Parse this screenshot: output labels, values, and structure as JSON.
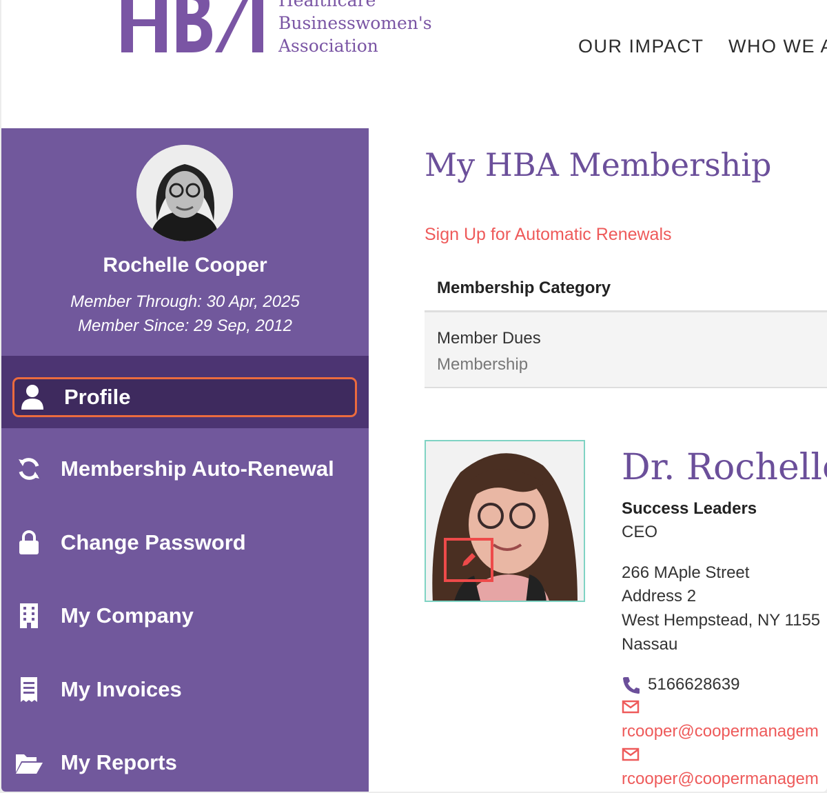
{
  "header": {
    "logo_lines": [
      "Healthcare",
      "Businesswomen's",
      "Association"
    ],
    "nav": [
      "OUR IMPACT",
      "WHO WE A"
    ]
  },
  "sidebar": {
    "member_name": "Rochelle Cooper",
    "member_through": "Member Through: 30 Apr, 2025",
    "member_since": "Member Since: 29 Sep, 2012",
    "items": [
      {
        "label": "Profile",
        "icon": "user-icon",
        "active": true
      },
      {
        "label": "Membership Auto-Renewal",
        "icon": "refresh-icon"
      },
      {
        "label": "Change Password",
        "icon": "lock-icon"
      },
      {
        "label": "My Company",
        "icon": "building-icon"
      },
      {
        "label": "My Invoices",
        "icon": "receipt-icon"
      },
      {
        "label": "My Reports",
        "icon": "folder-open-icon"
      }
    ]
  },
  "main": {
    "title": "My HBA Membership",
    "renew_link": "Sign Up for Automatic Renewals",
    "table": {
      "header": "Membership Category",
      "row_line1": "Member Dues",
      "row_line2": "Membership"
    },
    "card": {
      "name": "Dr. Rochelle",
      "company": "Success Leaders",
      "title": "CEO",
      "address1": "266 MAple Street",
      "address2": "Address 2",
      "city": "West Hempstead, NY 1155",
      "county": "Nassau",
      "phone": "5166628639",
      "email1": "rcooper@coopermanagem",
      "email2": "rcooper@coopermanagem"
    }
  },
  "colors": {
    "brand_purple": "#71589c",
    "active_purple": "#3e2a5e",
    "highlight_orange": "#ec6b3e",
    "link_red": "#ee5a5a"
  }
}
